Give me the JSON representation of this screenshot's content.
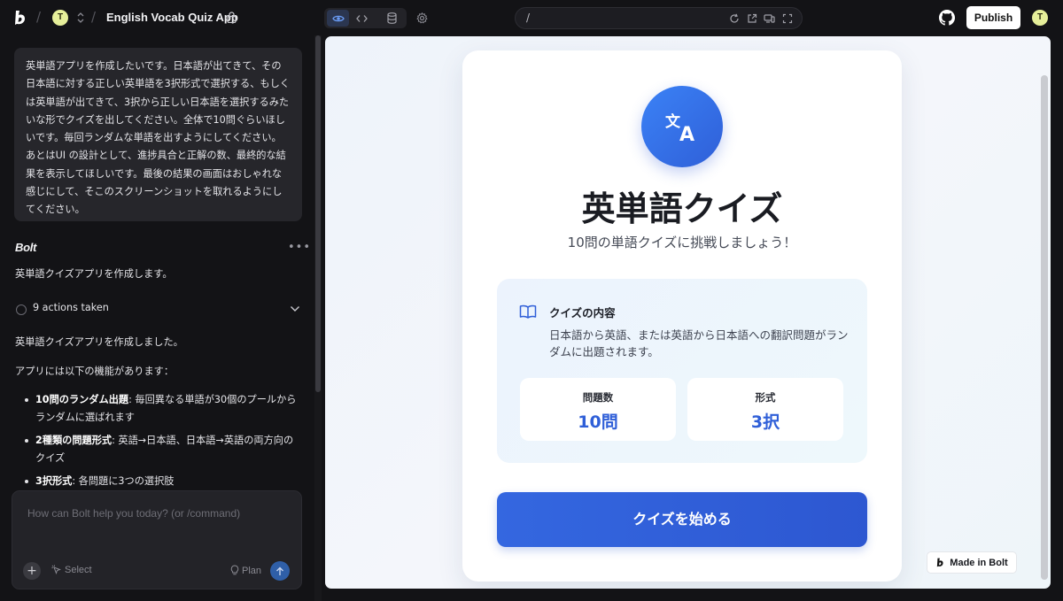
{
  "topbar": {
    "avatar_initial": "T",
    "project_title": "English Vocab Quiz App",
    "url_path": "/",
    "publish_label": "Publish",
    "user_initial": "T",
    "separator": "/"
  },
  "chat": {
    "user_message": "英単語アプリを作成したいです。日本語が出てきて、その日本語に対する正しい英単語を3択形式で選択する、もしくは英単語が出てきて、3択から正しい日本語を選択するみたいな形でクイズを出してください。全体で10問ぐらいほしいです。毎回ランダムな単語を出すようにしてください。あとはUI の設計として、進捗具合と正解の数、最終的な結果を表示してほしいです。最後の結果の画面はおしゃれな感じにして、そこのスクリーンショットを取れるようにしてください。",
    "assistant_name": "Bolt",
    "more_label": "•••",
    "intro": "英単語クイズアプリを作成します。",
    "actions_label": "9 actions taken",
    "done_text": "英単語クイズアプリを作成しました。",
    "features_intro": "アプリには以下の機能があります：",
    "features": [
      {
        "title": "10問のランダム出題",
        "desc": ": 毎回異なる単語が30個のプールからランダムに選ばれます"
      },
      {
        "title": "2種類の問題形式",
        "desc": ": 英語→日本語、日本語→英語の両方向のクイズ"
      },
      {
        "title": "3択形式",
        "desc": ": 各問題に3つの選択肢"
      }
    ]
  },
  "composer": {
    "placeholder": "How can Bolt help you today? (or /command)",
    "plus_label": "+",
    "select_label": "Select",
    "plan_label": "Plan"
  },
  "preview": {
    "title": "英単語クイズ",
    "subtitle": "10問の単語クイズに挑戦しましょう！",
    "info_title": "クイズの内容",
    "info_desc": "日本語から英語、または英語から日本語への翻訳問題がランダムに出題されます。",
    "stats": [
      {
        "label": "問題数",
        "value": "10問"
      },
      {
        "label": "形式",
        "value": "3択"
      }
    ],
    "start_label": "クイズを始める",
    "made_in": "Made in Bolt"
  }
}
